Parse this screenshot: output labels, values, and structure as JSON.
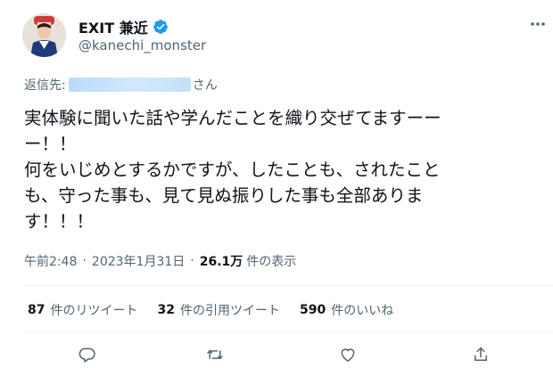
{
  "author": {
    "name": "EXIT 兼近",
    "handle": "@kanechi_monster"
  },
  "reply": {
    "prefix": "返信先:",
    "suffix": "さん"
  },
  "tweet": {
    "text": "実体験に聞いた話や学んだことを織り交ぜてますーー\nー！！\n何をいじめとするかですが、したことも、されたこと\nも、守った事も、見て見ぬ振りした事も全部ありま\nす！！！"
  },
  "meta": {
    "time": "午前2:48",
    "sep1": "·",
    "date": "2023年1月31日",
    "sep2": "·",
    "views_count": "26.1万",
    "views_label": "件の表示"
  },
  "stats": {
    "retweets_count": "87",
    "retweets_label": "件のリツイート",
    "quotes_count": "32",
    "quotes_label": "件の引用ツイート",
    "likes_count": "590",
    "likes_label": "件のいいね"
  },
  "colors": {
    "text": "#0f1419",
    "secondary": "#536471",
    "verified": "#1d9bf0",
    "divider": "#eff3f4"
  },
  "icons": [
    "verified-badge-icon",
    "more-icon",
    "reply-icon",
    "retweet-icon",
    "like-icon",
    "share-icon"
  ]
}
